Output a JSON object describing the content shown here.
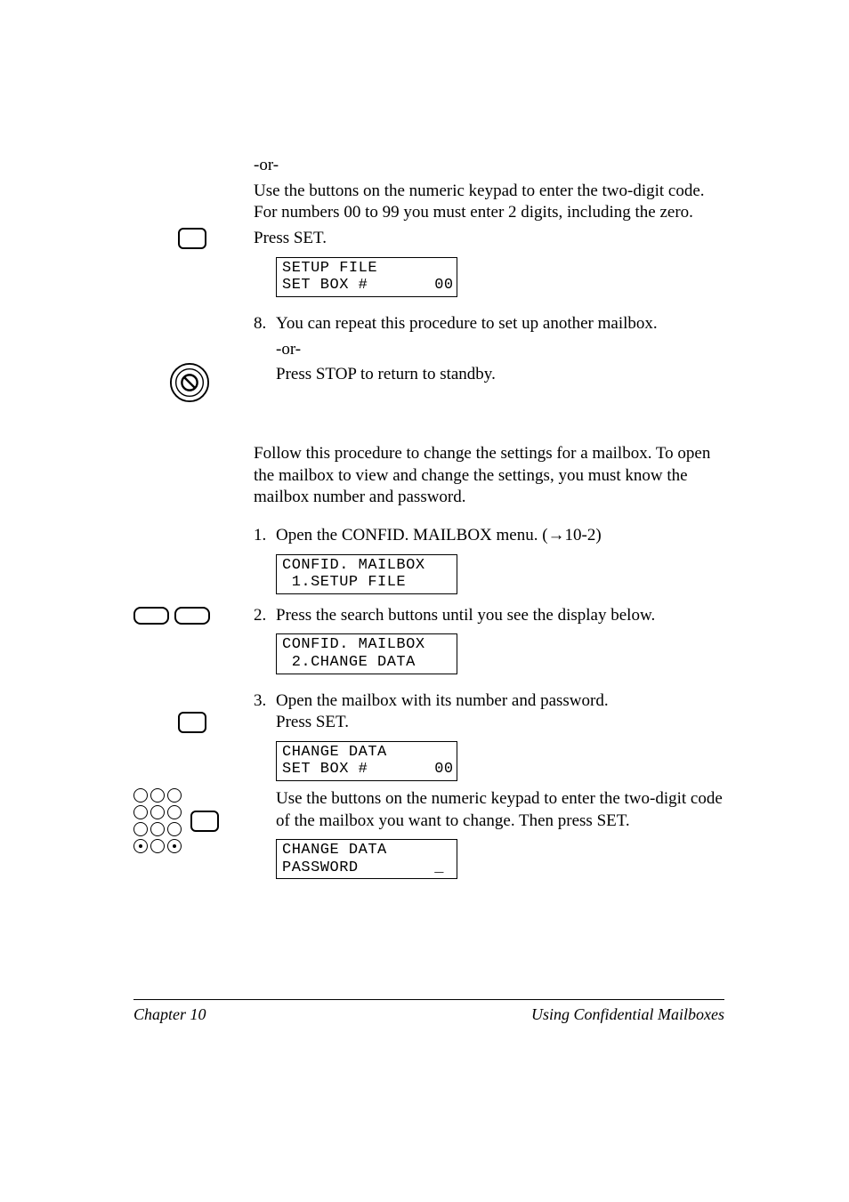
{
  "body": {
    "or1": "-or-",
    "keypad_entry": "Use the buttons on the numeric keypad to enter the two-digit code. For numbers 00 to 99 you must enter 2 digits, including the zero.",
    "press_set1": "Press SET.",
    "display1_line1": "SETUP FILE",
    "display1_line2": "SET BOX #       00",
    "step8_num": "8.",
    "step8_text": "You can repeat this procedure to set up another mailbox.",
    "or2": "-or-",
    "press_stop": "Press STOP to return to standby.",
    "change_intro": "Follow this procedure to change the settings for a mailbox. To open the mailbox to view and change the settings, you must know the mailbox number and password.",
    "step1_num": "1.",
    "step1_text": "Open the CONFID. MAILBOX menu. (→10-2)",
    "display2_line1": "CONFID. MAILBOX",
    "display2_line2": " 1.SETUP FILE",
    "step2_num": "2.",
    "step2_text": "Press the search buttons until you see the display below.",
    "display3_line1": "CONFID. MAILBOX",
    "display3_line2": " 2.CHANGE DATA",
    "step3_num": "3.",
    "step3_text": "Open the mailbox with its number and password.",
    "press_set2": "Press SET.",
    "display4_line1": "CHANGE DATA",
    "display4_line2": "SET BOX #       00",
    "keypad_change": "Use the buttons on the numeric keypad to enter the two-digit code of the mailbox you want to change. Then press SET.",
    "display5_line1": "CHANGE DATA",
    "display5_line2": "PASSWORD        _"
  },
  "footer": {
    "left": "Chapter 10",
    "right": "Using Confidential Mailboxes"
  }
}
